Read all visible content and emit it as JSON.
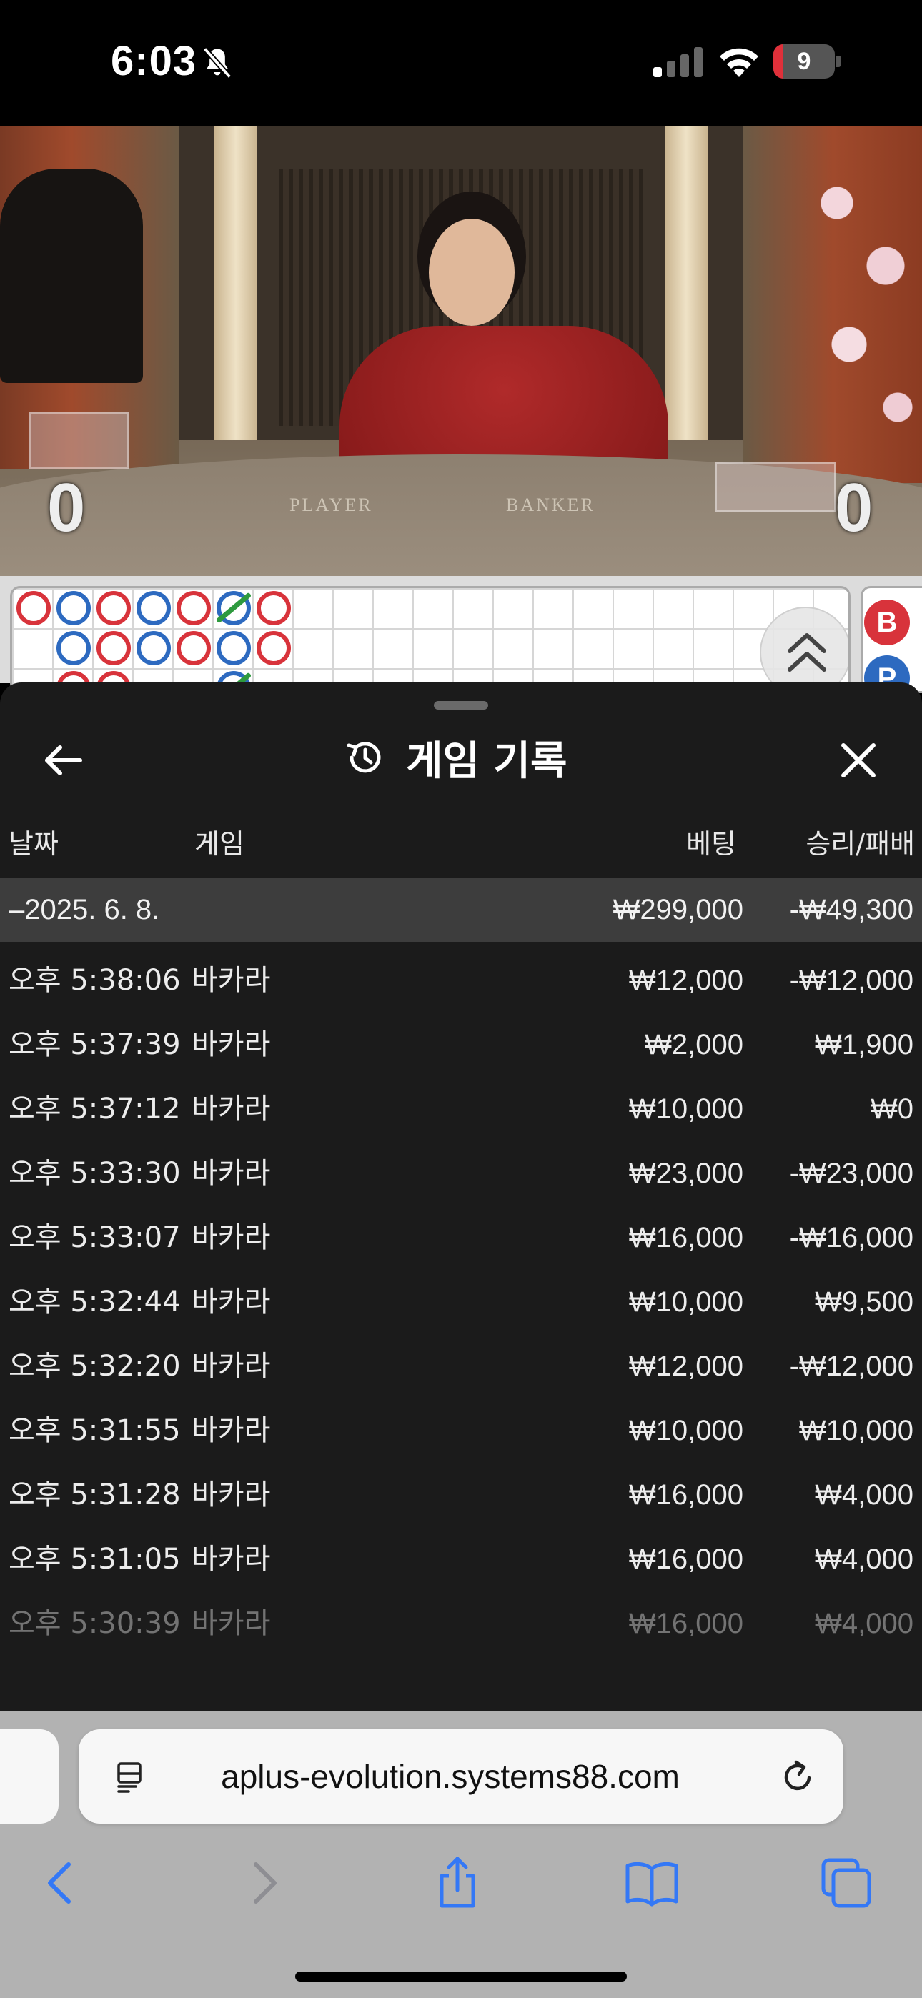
{
  "status_bar": {
    "time": "6:03",
    "battery_level": "9",
    "battery_fraction": 0.09
  },
  "video": {
    "player_score": "0",
    "banker_score": "0",
    "table_label_player": "PLAYER",
    "table_label_banker": "BANKER"
  },
  "roadmap": {
    "side_chips": [
      "B",
      "P"
    ]
  },
  "sheet": {
    "title": "게임 기록",
    "headers": {
      "date": "날짜",
      "game": "게임",
      "bet": "베팅",
      "result": "승리/패배"
    },
    "group": {
      "date": "–2025. 6. 8.",
      "bet": "₩299,000",
      "result": "-₩49,300"
    },
    "rows": [
      {
        "time": "오후 5:38:06",
        "game": "바카라",
        "bet": "₩12,000",
        "result": "-₩12,000"
      },
      {
        "time": "오후 5:37:39",
        "game": "바카라",
        "bet": "₩2,000",
        "result": "₩1,900"
      },
      {
        "time": "오후 5:37:12",
        "game": "바카라",
        "bet": "₩10,000",
        "result": "₩0"
      },
      {
        "time": "오후 5:33:30",
        "game": "바카라",
        "bet": "₩23,000",
        "result": "-₩23,000"
      },
      {
        "time": "오후 5:33:07",
        "game": "바카라",
        "bet": "₩16,000",
        "result": "-₩16,000"
      },
      {
        "time": "오후 5:32:44",
        "game": "바카라",
        "bet": "₩10,000",
        "result": "₩9,500"
      },
      {
        "time": "오후 5:32:20",
        "game": "바카라",
        "bet": "₩12,000",
        "result": "-₩12,000"
      },
      {
        "time": "오후 5:31:55",
        "game": "바카라",
        "bet": "₩10,000",
        "result": "₩10,000"
      },
      {
        "time": "오후 5:31:28",
        "game": "바카라",
        "bet": "₩16,000",
        "result": "₩4,000"
      },
      {
        "time": "오후 5:31:05",
        "game": "바카라",
        "bet": "₩16,000",
        "result": "₩4,000"
      },
      {
        "time": "오후 5:30:39",
        "game": "바카라",
        "bet": "₩16,000",
        "result": "₩4,000"
      }
    ]
  },
  "browser": {
    "url": "aplus-evolution.systems88.com"
  },
  "icons": {
    "status": [
      "bell-slash-icon",
      "cellular-signal-icon",
      "wifi-icon",
      "battery-icon"
    ],
    "sheet": [
      "back-arrow-icon",
      "history-icon",
      "close-icon"
    ],
    "roadmap": [
      "chevron-up-double-icon"
    ],
    "browser": [
      "page-menu-icon",
      "reload-icon",
      "back-icon",
      "forward-icon",
      "share-icon",
      "bookmarks-icon",
      "tabs-icon"
    ]
  },
  "colors": {
    "banker_red": "#d8333b",
    "player_blue": "#2d6ac0",
    "tie_green": "#2e9a3e",
    "sheet_bg": "#1b1b1b",
    "group_row_bg": "#3d3d3d",
    "ios_blue": "#3478f6"
  }
}
